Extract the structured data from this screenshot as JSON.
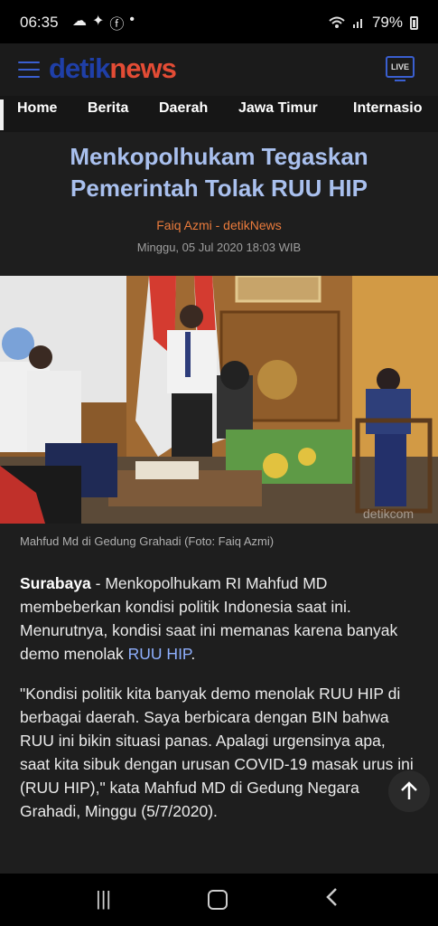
{
  "status": {
    "time": "06:35",
    "battery": "79%"
  },
  "app": {
    "logo_detik": "detik",
    "logo_news": "news",
    "live_label": "LIVE"
  },
  "nav": {
    "items": [
      "Home",
      "Berita",
      "Daerah",
      "Jawa Timur",
      "Internasio"
    ]
  },
  "article": {
    "title": "Menkopolhukam Tegaskan Pemerintah Tolak RUU HIP",
    "byline": "Faiq Azmi - detikNews",
    "date": "Minggu, 05 Jul 2020 18:03 WIB",
    "photo_watermark": "detikcom",
    "caption": "Mahfud Md di Gedung Grahadi (Foto: Faiq Azmi)",
    "p1_location": "Surabaya",
    "p1_text": " - Menkopolhukam RI Mahfud MD membeberkan kondisi politik Indonesia saat ini. Menurutnya, kondisi saat ini memanas karena banyak demo menolak ",
    "p1_link": "RUU HIP",
    "p1_end": ".",
    "p2_text": "\"Kondisi politik kita banyak demo menolak RUU HIP di berbagai daerah. Saya berbicara dengan BIN bahwa RUU ini bikin situasi panas. Apalagi urgensinya apa, saat kita sibuk dengan urusan COVID-19 masak urus ini (RUU HIP),\" kata Mahfud MD di Gedung Negara Grahadi, Minggu (5/7/2020)."
  },
  "colors": {
    "title": "#a9c0ee",
    "byline": "#ea7b3c",
    "logo_detik": "#1f3fa8",
    "logo_news": "#e34c35",
    "link": "#8fb0ff"
  }
}
